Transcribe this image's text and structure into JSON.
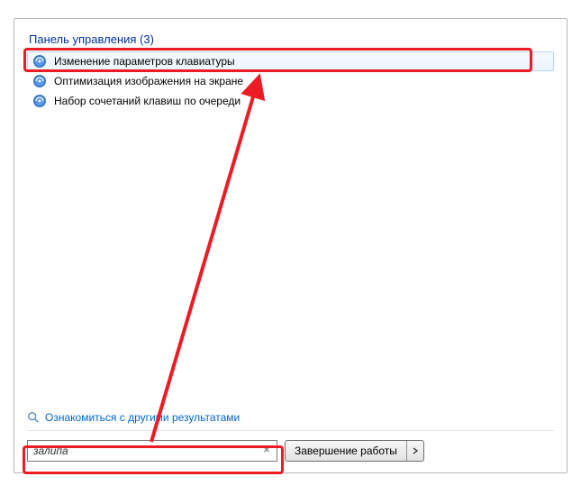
{
  "section_header": "Панель управления (3)",
  "results": [
    {
      "label": "Изменение параметров клавиатуры"
    },
    {
      "label": "Оптимизация изображения на экране"
    },
    {
      "label": "Набор сочетаний клавиш по очереди"
    }
  ],
  "more_results_label": "Ознакомиться с другими результатами",
  "search_value": "залипа",
  "shutdown_label": "Завершение работы",
  "annotation_color": "#ec1c24"
}
